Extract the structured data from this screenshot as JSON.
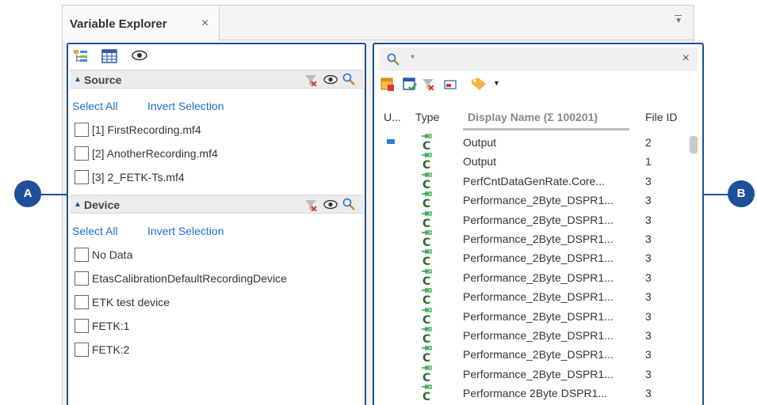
{
  "tab": {
    "title": "Variable Explorer",
    "close": "×"
  },
  "source": {
    "title": "Source",
    "select_all": "Select All",
    "invert": "Invert Selection",
    "items": [
      "[1] FirstRecording.mf4",
      "[2] AnotherRecording.mf4",
      "[3] 2_FETK-Ts.mf4"
    ]
  },
  "device": {
    "title": "Device",
    "select_all": "Select All",
    "invert": "Invert Selection",
    "items": [
      "No Data",
      "EtasCalibrationDefaultRecordingDevice",
      "ETK test device",
      "FETK:1",
      "FETK:2"
    ]
  },
  "search": {
    "value": "*",
    "close": "×"
  },
  "columns": {
    "u": "U...",
    "type": "Type",
    "display": "Display Name (Σ 100201)",
    "file_id": "File ID"
  },
  "rows": [
    {
      "name": "Output",
      "file_id": "2"
    },
    {
      "name": "Output",
      "file_id": "1"
    },
    {
      "name": "PerfCntDataGenRate.Core...",
      "file_id": "3"
    },
    {
      "name": "Performance_2Byte_DSPR1...",
      "file_id": "3"
    },
    {
      "name": "Performance_2Byte_DSPR1...",
      "file_id": "3"
    },
    {
      "name": "Performance_2Byte_DSPR1...",
      "file_id": "3"
    },
    {
      "name": "Performance_2Byte_DSPR1...",
      "file_id": "3"
    },
    {
      "name": "Performance_2Byte_DSPR1...",
      "file_id": "3"
    },
    {
      "name": "Performance_2Byte_DSPR1...",
      "file_id": "3"
    },
    {
      "name": "Performance_2Byte_DSPR1...",
      "file_id": "3"
    },
    {
      "name": "Performance_2Byte_DSPR1...",
      "file_id": "3"
    },
    {
      "name": "Performance_2Byte_DSPR1...",
      "file_id": "3"
    },
    {
      "name": "Performance_2Byte_DSPR1...",
      "file_id": "3"
    },
    {
      "name": "Performance 2Byte DSPR1...",
      "file_id": "3"
    }
  ],
  "callouts": {
    "a": "A",
    "b": "B"
  },
  "colors": {
    "accent": "#1f4e9c",
    "link": "#1a6fd1"
  }
}
